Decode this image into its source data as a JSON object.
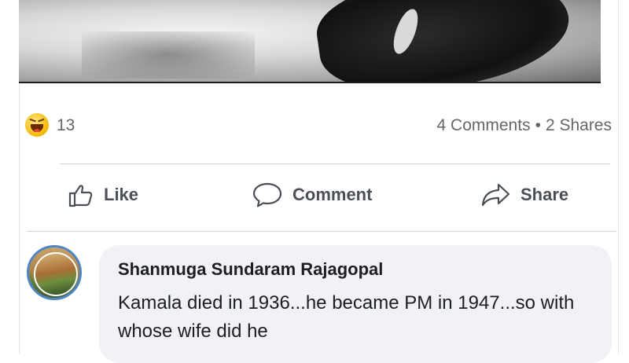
{
  "post": {
    "reactions": {
      "icon": "haha-emoji-icon",
      "count": "13"
    },
    "stats": {
      "comments": "4 Comments",
      "separator": "•",
      "shares": "2 Shares"
    },
    "actions": {
      "like": {
        "label": "Like",
        "icon": "thumbs-up-icon"
      },
      "comment": {
        "label": "Comment",
        "icon": "speech-bubble-icon"
      },
      "share": {
        "label": "Share",
        "icon": "share-arrow-icon"
      }
    }
  },
  "comment": {
    "author": "Shanmuga Sundaram Rajagopal",
    "text": "Kamala died in 1936...he became PM in 1947...so with whose wife did he"
  },
  "colors": {
    "secondary_text": "#65676b",
    "bubble_bg": "#f0f2f5",
    "avatar_ring": "#4f86c6"
  }
}
